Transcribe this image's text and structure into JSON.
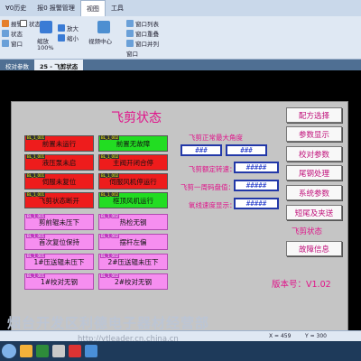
{
  "ribbon": {
    "tabs": [
      "Ɐ0历史",
      "报0 报警管理",
      "视图",
      "工具"
    ],
    "row1": [
      "报警",
      "状态栏",
      "放大",
      "窗口列表"
    ],
    "row2": [
      "缩放",
      "缩小",
      "视频中心",
      "窗口重叠"
    ],
    "row3": [
      "100%",
      "窗口并列"
    ],
    "row4": [
      "状态",
      "窗口"
    ],
    "zoom_value": "100%"
  },
  "doc_tabs": [
    "校对参数",
    "25 - 飞剪状态"
  ],
  "screen": {
    "title": "飞剪状态",
    "left_buttons": [
      {
        "tag": "BL_1_001",
        "label": "前置未运行",
        "color": "red"
      },
      {
        "tag": "BL_1_001",
        "label": "液压泵未启",
        "color": "red"
      },
      {
        "tag": "BL_1_001",
        "label": "伺服未复位",
        "color": "red"
      },
      {
        "tag": "BL_1_001",
        "label": "飞剪状态断开",
        "color": "red"
      },
      {
        "tag": "BL_1_001",
        "label": "剪前辊未压下",
        "color": "pink"
      },
      {
        "tag": "BL_1_001",
        "label": "首次复位保持",
        "color": "pink"
      },
      {
        "tag": "BL_1_001",
        "label": "1#压送辊未压下",
        "color": "pink"
      },
      {
        "tag": "BL_1_001",
        "label": "1#校对无钢",
        "color": "pink"
      }
    ],
    "mid_buttons": [
      {
        "tag": "BL_1_002",
        "label": "前置无故障",
        "color": "green"
      },
      {
        "tag": "BL_1_002",
        "label": "主阀开闭合停",
        "color": "red"
      },
      {
        "tag": "BL_1_002",
        "label": "伺服风机停运行",
        "color": "red"
      },
      {
        "tag": "BL_1_002",
        "label": "框顶风机运行",
        "color": "green"
      },
      {
        "tag": "BL_1_002",
        "label": "热检无钢",
        "color": "pink"
      },
      {
        "tag": "BL_1_002",
        "label": "摆杆左偏",
        "color": "pink"
      },
      {
        "tag": "BL_1_002",
        "label": "2#压送辊未压下",
        "color": "pink"
      },
      {
        "tag": "BL_1_002",
        "label": "2#校对无钢",
        "color": "pink"
      }
    ],
    "angle_label": "飞剪正常最大角度",
    "angle_value_1": "###",
    "angle_value_2": "###",
    "fields": [
      {
        "label": "飞剪额定转速：",
        "value": "#####"
      },
      {
        "label": "飞剪一周码盘值：",
        "value": "#####"
      },
      {
        "label": "氧线速度显示：",
        "value": "#####"
      }
    ],
    "right_buttons": [
      "配方选择",
      "参数显示",
      "校对参数",
      "尾钢处理",
      "系统参数",
      "短尾及夹送"
    ],
    "status_label": "飞剪状态",
    "fault_button": "故障信息",
    "version": "版本号：V1.02"
  },
  "watermark": "烟台开发区利德电子器材经营部",
  "watermark_url": "http://ytleader.cn.china.cn",
  "statusbar": {
    "x": "X = 459",
    "y": "Y = 300"
  }
}
